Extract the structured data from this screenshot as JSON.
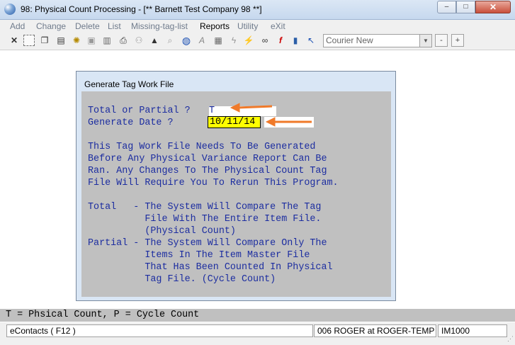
{
  "window": {
    "title": "98: Physical Count Processing - [** Barnett Test Company 98 **]",
    "buttons": {
      "minimize": "–",
      "maximize": "□",
      "close": "✕"
    }
  },
  "menu": [
    {
      "label": "Add",
      "active": false
    },
    {
      "label": "Change",
      "active": false
    },
    {
      "label": "Delete",
      "active": false
    },
    {
      "label": "List",
      "active": false
    },
    {
      "label": "Missing-tag-list",
      "active": false
    },
    {
      "label": "Reports",
      "active": true
    },
    {
      "label": "Utility",
      "active": false
    },
    {
      "label": "eXit",
      "active": false
    }
  ],
  "toolbar": {
    "font_name": "Courier New",
    "font_minus": "-",
    "font_plus": "+",
    "icons": [
      "close-x-icon",
      "select-box-icon",
      "copy-icon",
      "paste-icon",
      "settings-gear-icon",
      "properties-icon",
      "document-icon",
      "print-icon",
      "binoculars-icon",
      "search-icon",
      "globe-icon",
      "font-icon",
      "calculator-icon",
      "lightning-icon",
      "link-icon",
      "function-icon",
      "notepad-icon",
      "help-pointer-icon"
    ]
  },
  "dialog": {
    "title": "Generate Tag Work File",
    "line1_label": "Total or Partial ?",
    "total_value": "T",
    "line2_label": "Generate Date ?",
    "date_value": "10/11/14",
    "description": [
      "This Tag Work File Needs To Be Generated",
      "Before Any Physical Variance Report Can Be",
      "Ran. Any Changes To The Physical Count Tag",
      "File Will Require You To Rerun This Program."
    ],
    "options": [
      "Total   - The System Will Compare The Tag",
      "          File With The Entire Item File.",
      "          (Physical Count)",
      "Partial - The System Will Compare Only The",
      "          Items In The Item Master File",
      "          That Has Been Counted In Physical",
      "          Tag File. (Cycle Count)"
    ]
  },
  "status": {
    "hint": "T = Phsical Count, P = Cycle Count",
    "econtacts": "eContacts ( F12 )",
    "user": "006 ROGER at ROGER-TEMP",
    "module": "IM1000"
  },
  "colors": {
    "arrow": "#f07a2a",
    "date_bg": "#ffff00",
    "text": "#1c2da0"
  }
}
